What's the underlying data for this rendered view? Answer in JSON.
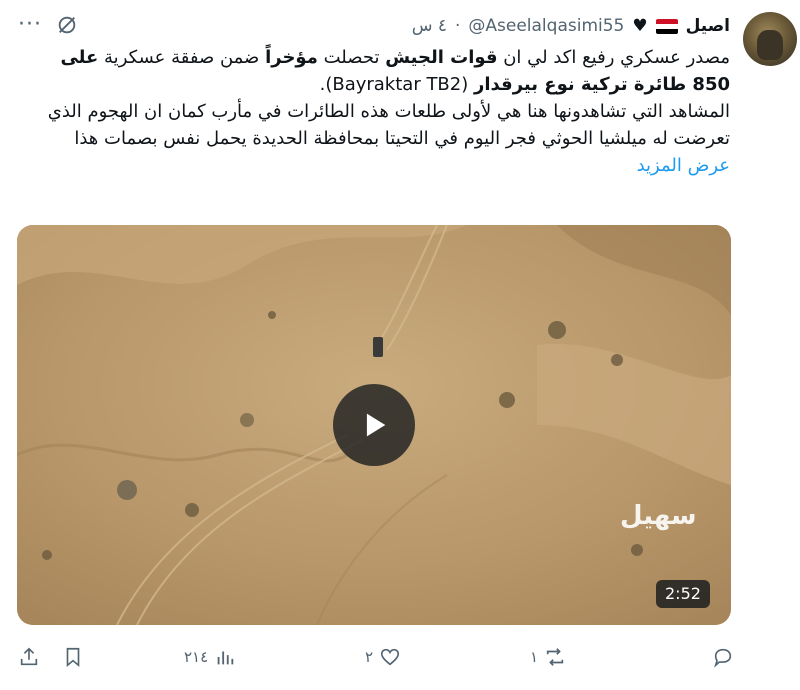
{
  "tweet": {
    "display_name": "اصيل",
    "handle": "@Aseelalqasimi55",
    "time": "٤ س",
    "dot": "·",
    "more": "···",
    "text": {
      "p1_a": "مصدر عسكري رفيع اكد لي ان ",
      "p1_b": "قوات الجيش",
      "p1_c": " تحصلت ",
      "p1_d": "مؤخراً",
      "p1_e": " ضمن صفقة عسكرية ",
      "p1_f": "على 850 طائرة تركية نوع بيرقدار",
      "p1_g": " (Bayraktar TB2).",
      "p2": "المشاهد التي تشاهدونها هنا هي لأولى طلعات هذه الطائرات في مأرب كمان ان الهجوم الذي تعرضت له ميلشيا الحوثي فجر اليوم في التحيتا بمحافظة الحديدة يحمل نفس بصمات هذا"
    },
    "show_more": "عرض المزيد"
  },
  "media": {
    "duration": "2:52",
    "watermark": "سهيل"
  },
  "actions": {
    "replies": "",
    "reposts": "١",
    "likes": "٢",
    "views": "٢١٤"
  },
  "colors": {
    "accent": "#1d9bf0",
    "muted": "#536471",
    "flag_red": "#ce1126",
    "flag_white": "#ffffff",
    "flag_black": "#000000"
  },
  "icons": [
    "more-icon",
    "grok-icon",
    "heart-icon",
    "flag-icon",
    "play-icon",
    "reply-icon",
    "repost-icon",
    "like-icon",
    "views-icon",
    "bookmark-icon",
    "share-icon"
  ]
}
